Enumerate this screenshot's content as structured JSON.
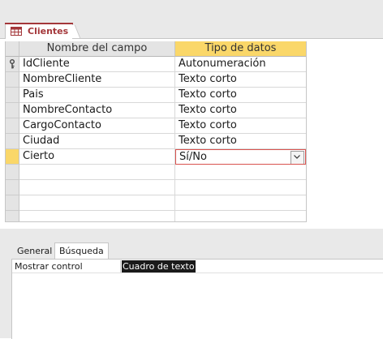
{
  "document_tab": {
    "label": "Clientes",
    "icon": "table-icon"
  },
  "grid": {
    "headers": {
      "field_name": "Nombre del campo",
      "data_type": "Tipo de datos"
    },
    "rows": [
      {
        "field": "IdCliente",
        "type": "Autonumeración",
        "primary_key": true
      },
      {
        "field": "NombreCliente",
        "type": "Texto corto"
      },
      {
        "field": "Pais",
        "type": "Texto corto"
      },
      {
        "field": "NombreContacto",
        "type": "Texto corto"
      },
      {
        "field": "CargoContacto",
        "type": "Texto corto"
      },
      {
        "field": "Ciudad",
        "type": "Texto corto"
      },
      {
        "field": "Cierto",
        "type": "Sí/No",
        "current": true
      }
    ]
  },
  "properties": {
    "tabs": {
      "general": "General",
      "lookup": "Búsqueda"
    },
    "active_tab": "Búsqueda",
    "items": [
      {
        "label": "Mostrar control",
        "value": "Cuadro de texto"
      }
    ]
  },
  "colors": {
    "accent": "#a4373a",
    "highlight": "#fad769",
    "current_border": "#d9534f"
  }
}
